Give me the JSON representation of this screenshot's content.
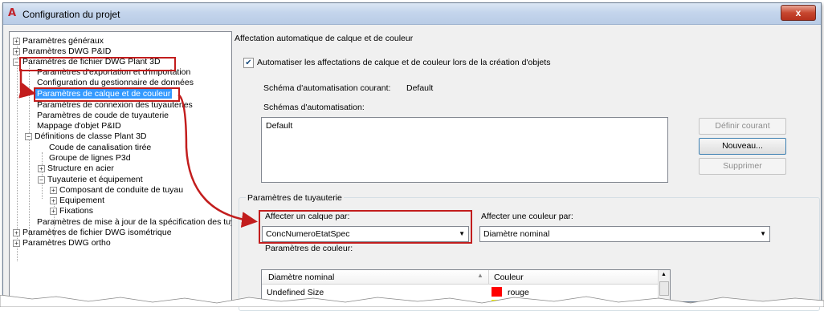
{
  "window": {
    "title": "Configuration du projet",
    "close_label": "x"
  },
  "tree": {
    "items": [
      {
        "label": "Paramètres généraux",
        "expander": "+"
      },
      {
        "label": "Paramètres DWG P&ID",
        "expander": "+"
      },
      {
        "label": "Paramètres de fichier DWG Plant 3D",
        "expander": "−"
      },
      {
        "label": "Paramètres d'exportation et d'importation"
      },
      {
        "label": "Configuration du gestionnaire de données"
      },
      {
        "label": "Paramètres de calque et de couleur",
        "selected": true
      },
      {
        "label": "Paramètres de connexion des tuyauteries"
      },
      {
        "label": "Paramètres de coude de tuyauterie"
      },
      {
        "label": "Mappage d'objet P&ID"
      },
      {
        "label": "Définitions de classe Plant 3D",
        "expander": "−"
      },
      {
        "label": "Coude de canalisation tirée"
      },
      {
        "label": "Groupe de lignes P3d"
      },
      {
        "label": "Structure en acier",
        "expander": "+"
      },
      {
        "label": "Tuyauterie et équipement",
        "expander": "−"
      },
      {
        "label": "Composant de conduite de tuyau",
        "expander": "+"
      },
      {
        "label": "Equipement",
        "expander": "+"
      },
      {
        "label": "Fixations",
        "expander": "+"
      },
      {
        "label": "Paramètres de mise à jour de la spécification des tuy"
      },
      {
        "label": "Paramètres de fichier DWG isométrique",
        "expander": "+"
      },
      {
        "label": "Paramètres DWG ortho",
        "expander": "+"
      }
    ]
  },
  "main": {
    "section_title": "Affectation automatique de calque et de couleur",
    "auto_checkbox_label": "Automatiser les affectations de calque et de couleur lors de la création d'objets",
    "auto_checked": true,
    "current_scheme_label": "Schéma d'automatisation courant:",
    "current_scheme_value": "Default",
    "schemes_label": "Schémas d'automatisation:",
    "schemes": [
      "Default"
    ],
    "buttons": {
      "set_current": "Définir courant",
      "new": "Nouveau...",
      "delete": "Supprimer"
    },
    "piping_group_title": "Paramètres de tuyauterie",
    "layer_label": "Affecter un calque par:",
    "layer_value": "ConcNumeroEtatSpec",
    "color_label": "Affecter une couleur par:",
    "color_value": "Diamètre nominal",
    "color_params_label": "Paramètres de couleur:",
    "grid": {
      "headers": [
        "Diamètre nominal",
        "Couleur"
      ],
      "rows": [
        {
          "size": "Undefined Size",
          "color_name": "rouge",
          "color_hex": "#ff0000"
        },
        {
          "size": "",
          "color_name": "",
          "color_hex": "#ffff00"
        }
      ]
    }
  },
  "colors": {
    "annotation_red": "#c21d1d",
    "selection_blue": "#3399ff"
  }
}
